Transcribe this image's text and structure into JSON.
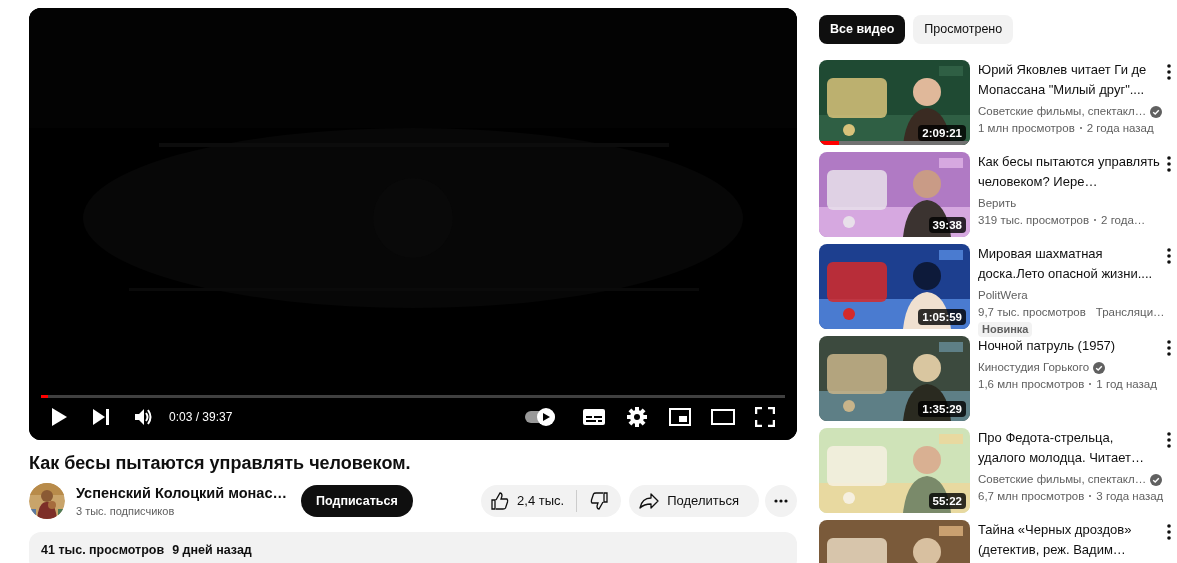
{
  "player": {
    "progress": {
      "level": 0.01
    },
    "time": "0:03 / 39:37",
    "autoplay": {
      "on": true
    }
  },
  "video": {
    "title": "Как бесы пытаются управлять человеком.",
    "channel": {
      "name": "Успенский Колоцкий монас…",
      "subscribers": "3 тыс. подписчиков"
    },
    "subscribe": "Подписаться",
    "likes": "2,4 тыс.",
    "share": "Поделиться",
    "description": {
      "views": "41 тыс. просмотров",
      "age": "9 дней назад"
    }
  },
  "chips": [
    {
      "label": "Все видео",
      "selected": true
    },
    {
      "label": "Просмотрено",
      "selected": false
    }
  ],
  "related": [
    {
      "title": "Юрий Яковлев читает Ги де Мопассана \"Милый друг\"....",
      "channel": "Советские фильмы, спектакл…",
      "verified": true,
      "meta": [
        "1 млн просмотров",
        "2 года назад"
      ],
      "duration": "2:09:21",
      "watched": {
        "level": 0.13
      }
    },
    {
      "title": "Как бесы пытаются управлять человеком? Иере…",
      "channel": "Верить",
      "verified": false,
      "meta": [
        "319 тыс. просмотров",
        "2 года…"
      ],
      "duration": "39:38"
    },
    {
      "title": "Мировая шахматная доска.Лето опасной жизни....",
      "channel": "PolitWera",
      "verified": false,
      "meta": [
        "9,7 тыс. просмотров",
        "Трансляци…"
      ],
      "duration": "1:05:59",
      "badge": "Новинка"
    },
    {
      "title": "Ночной патруль (1957)",
      "channel": "Киностудия Горького",
      "verified": true,
      "meta": [
        "1,6 млн просмотров",
        "1 год назад"
      ],
      "duration": "1:35:29"
    },
    {
      "title": "Про Федота-стрельца, удалого молодца. Читает…",
      "channel": "Советские фильмы, спектакл…",
      "verified": true,
      "meta": [
        "6,7 млн просмотров",
        "3 года назад"
      ],
      "duration": "55:22"
    },
    {
      "title": "Тайна «Черных дроздов» (детектив, реж. Вадим…"
    }
  ]
}
